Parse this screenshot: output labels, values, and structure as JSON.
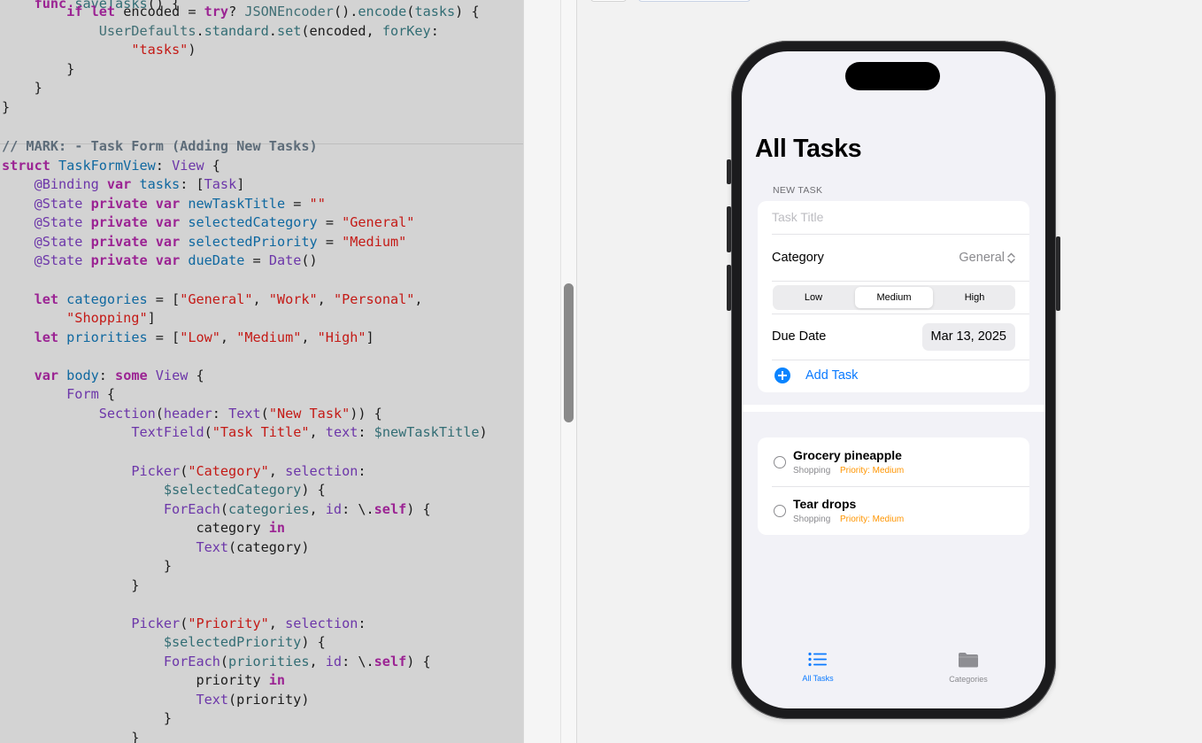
{
  "code_lines": [
    {
      "t": 4,
      "segs": [
        [
          "    ",
          ""
        ],
        [
          "func",
          "kw"
        ],
        [
          " ",
          ""
        ],
        [
          "saveTasks",
          "fn"
        ],
        [
          "() {",
          ""
        ]
      ]
    },
    {
      "t": 13,
      "segs": [
        [
          "        ",
          ""
        ],
        [
          "if",
          "kw"
        ],
        [
          " ",
          ""
        ],
        [
          "let",
          "kw"
        ],
        [
          " encoded = ",
          ""
        ],
        [
          "try",
          "kw"
        ],
        [
          "? ",
          ""
        ],
        [
          "JSONEncoder",
          "ty"
        ],
        [
          "().",
          ""
        ],
        [
          "encode",
          "fn"
        ],
        [
          "(",
          ""
        ],
        [
          "tasks",
          "fn"
        ],
        [
          ") {",
          ""
        ]
      ]
    },
    {
      "t": 35,
      "segs": [
        [
          "            ",
          ""
        ],
        [
          "UserDefaults",
          "ty"
        ],
        [
          ".",
          ""
        ],
        [
          "standard",
          "fn"
        ],
        [
          ".",
          ""
        ],
        [
          "set",
          "fn"
        ],
        [
          "(encoded, ",
          ""
        ],
        [
          "forKey",
          "fn"
        ],
        [
          ":",
          ""
        ]
      ]
    },
    {
      "t": 56,
      "segs": [
        [
          "                ",
          ""
        ],
        [
          "\"tasks\"",
          "str"
        ],
        [
          ")",
          ""
        ]
      ]
    },
    {
      "t": 78,
      "segs": [
        [
          "        }",
          ""
        ]
      ]
    },
    {
      "t": 99,
      "segs": [
        [
          "    }",
          ""
        ]
      ]
    },
    {
      "t": 121,
      "segs": [
        [
          "}",
          ""
        ]
      ]
    },
    {
      "t": 165,
      "segs": [
        [
          "// MARK: - Task Form (Adding New Tasks)",
          "cm"
        ]
      ]
    },
    {
      "t": 187,
      "segs": [
        [
          "struct",
          "kw"
        ],
        [
          " ",
          ""
        ],
        [
          "TaskFormView",
          "id"
        ],
        [
          ": ",
          ""
        ],
        [
          "View",
          "pr"
        ],
        [
          " {",
          ""
        ]
      ]
    },
    {
      "t": 208,
      "segs": [
        [
          "    ",
          ""
        ],
        [
          "@Binding",
          "pr"
        ],
        [
          " ",
          ""
        ],
        [
          "var",
          "kw"
        ],
        [
          " ",
          ""
        ],
        [
          "tasks",
          "id"
        ],
        [
          ": [",
          ""
        ],
        [
          "Task",
          "pr"
        ],
        [
          "]",
          ""
        ]
      ]
    },
    {
      "t": 230,
      "segs": [
        [
          "    ",
          ""
        ],
        [
          "@State",
          "pr"
        ],
        [
          " ",
          ""
        ],
        [
          "private",
          "kw"
        ],
        [
          " ",
          ""
        ],
        [
          "var",
          "kw"
        ],
        [
          " ",
          ""
        ],
        [
          "newTaskTitle",
          "id"
        ],
        [
          " = ",
          ""
        ],
        [
          "\"\"",
          "str"
        ]
      ]
    },
    {
      "t": 251,
      "segs": [
        [
          "    ",
          ""
        ],
        [
          "@State",
          "pr"
        ],
        [
          " ",
          ""
        ],
        [
          "private",
          "kw"
        ],
        [
          " ",
          ""
        ],
        [
          "var",
          "kw"
        ],
        [
          " ",
          ""
        ],
        [
          "selectedCategory",
          "id"
        ],
        [
          " = ",
          ""
        ],
        [
          "\"General\"",
          "str"
        ]
      ]
    },
    {
      "t": 273,
      "segs": [
        [
          "    ",
          ""
        ],
        [
          "@State",
          "pr"
        ],
        [
          " ",
          ""
        ],
        [
          "private",
          "kw"
        ],
        [
          " ",
          ""
        ],
        [
          "var",
          "kw"
        ],
        [
          " ",
          ""
        ],
        [
          "selectedPriority",
          "id"
        ],
        [
          " = ",
          ""
        ],
        [
          "\"Medium\"",
          "str"
        ]
      ]
    },
    {
      "t": 294,
      "segs": [
        [
          "    ",
          ""
        ],
        [
          "@State",
          "pr"
        ],
        [
          " ",
          ""
        ],
        [
          "private",
          "kw"
        ],
        [
          " ",
          ""
        ],
        [
          "var",
          "kw"
        ],
        [
          " ",
          ""
        ],
        [
          "dueDate",
          "id"
        ],
        [
          " = ",
          ""
        ],
        [
          "Date",
          "pr"
        ],
        [
          "()",
          ""
        ]
      ]
    },
    {
      "t": 338,
      "segs": [
        [
          "    ",
          ""
        ],
        [
          "let",
          "kw"
        ],
        [
          " ",
          ""
        ],
        [
          "categories",
          "id"
        ],
        [
          " = [",
          ""
        ],
        [
          "\"General\"",
          "str"
        ],
        [
          ", ",
          ""
        ],
        [
          "\"Work\"",
          "str"
        ],
        [
          ", ",
          ""
        ],
        [
          "\"Personal\"",
          "str"
        ],
        [
          ",",
          ""
        ]
      ]
    },
    {
      "t": 359,
      "segs": [
        [
          "        ",
          ""
        ],
        [
          "\"Shopping\"",
          "str"
        ],
        [
          "]",
          ""
        ]
      ]
    },
    {
      "t": 381,
      "segs": [
        [
          "    ",
          ""
        ],
        [
          "let",
          "kw"
        ],
        [
          " ",
          ""
        ],
        [
          "priorities",
          "id"
        ],
        [
          " = [",
          ""
        ],
        [
          "\"Low\"",
          "str"
        ],
        [
          ", ",
          ""
        ],
        [
          "\"Medium\"",
          "str"
        ],
        [
          ", ",
          ""
        ],
        [
          "\"High\"",
          "str"
        ],
        [
          "]",
          ""
        ]
      ]
    },
    {
      "t": 424,
      "segs": [
        [
          "    ",
          ""
        ],
        [
          "var",
          "kw"
        ],
        [
          " ",
          ""
        ],
        [
          "body",
          "id"
        ],
        [
          ": ",
          ""
        ],
        [
          "some",
          "kw"
        ],
        [
          " ",
          ""
        ],
        [
          "View",
          "pr"
        ],
        [
          " {",
          ""
        ]
      ]
    },
    {
      "t": 445,
      "segs": [
        [
          "        ",
          ""
        ],
        [
          "Form",
          "pr"
        ],
        [
          " {",
          ""
        ]
      ]
    },
    {
      "t": 467,
      "segs": [
        [
          "            ",
          ""
        ],
        [
          "Section",
          "pr"
        ],
        [
          "(",
          ""
        ],
        [
          "header",
          "pr"
        ],
        [
          ": ",
          ""
        ],
        [
          "Text",
          "pr"
        ],
        [
          "(",
          ""
        ],
        [
          "\"New Task\"",
          "str"
        ],
        [
          ")) {",
          ""
        ]
      ]
    },
    {
      "t": 488,
      "segs": [
        [
          "                ",
          ""
        ],
        [
          "TextField",
          "pr"
        ],
        [
          "(",
          ""
        ],
        [
          "\"Task Title\"",
          "str"
        ],
        [
          ", ",
          ""
        ],
        [
          "text",
          "pr"
        ],
        [
          ": ",
          ""
        ],
        [
          "$newTaskTitle",
          "fn"
        ],
        [
          ")",
          ""
        ]
      ]
    },
    {
      "t": 532,
      "segs": [
        [
          "                ",
          ""
        ],
        [
          "Picker",
          "pr"
        ],
        [
          "(",
          ""
        ],
        [
          "\"Category\"",
          "str"
        ],
        [
          ", ",
          ""
        ],
        [
          "selection",
          "pr"
        ],
        [
          ":",
          ""
        ]
      ]
    },
    {
      "t": 553,
      "segs": [
        [
          "                    ",
          ""
        ],
        [
          "$selectedCategory",
          "fn"
        ],
        [
          ") {",
          ""
        ]
      ]
    },
    {
      "t": 575,
      "segs": [
        [
          "                    ",
          ""
        ],
        [
          "ForEach",
          "pr"
        ],
        [
          "(",
          ""
        ],
        [
          "categories",
          "fn"
        ],
        [
          ", ",
          ""
        ],
        [
          "id",
          "pr"
        ],
        [
          ": \\.",
          ""
        ],
        [
          "self",
          "kw"
        ],
        [
          ") {",
          ""
        ]
      ]
    },
    {
      "t": 596,
      "segs": [
        [
          "                        category ",
          ""
        ],
        [
          "in",
          "kw"
        ]
      ]
    },
    {
      "t": 618,
      "segs": [
        [
          "                        ",
          ""
        ],
        [
          "Text",
          "pr"
        ],
        [
          "(category)",
          ""
        ]
      ]
    },
    {
      "t": 639,
      "segs": [
        [
          "                    }",
          ""
        ]
      ]
    },
    {
      "t": 661,
      "segs": [
        [
          "                }",
          ""
        ]
      ]
    },
    {
      "t": 704,
      "segs": [
        [
          "                ",
          ""
        ],
        [
          "Picker",
          "pr"
        ],
        [
          "(",
          ""
        ],
        [
          "\"Priority\"",
          "str"
        ],
        [
          ", ",
          ""
        ],
        [
          "selection",
          "pr"
        ],
        [
          ":",
          ""
        ]
      ]
    },
    {
      "t": 725,
      "segs": [
        [
          "                    ",
          ""
        ],
        [
          "$selectedPriority",
          "fn"
        ],
        [
          ") {",
          ""
        ]
      ]
    },
    {
      "t": 747,
      "segs": [
        [
          "                    ",
          ""
        ],
        [
          "ForEach",
          "pr"
        ],
        [
          "(",
          ""
        ],
        [
          "priorities",
          "fn"
        ],
        [
          ", ",
          ""
        ],
        [
          "id",
          "pr"
        ],
        [
          ": \\.",
          ""
        ],
        [
          "self",
          "kw"
        ],
        [
          ") {",
          ""
        ]
      ]
    },
    {
      "t": 768,
      "segs": [
        [
          "                        priority ",
          ""
        ],
        [
          "in",
          "kw"
        ]
      ]
    },
    {
      "t": 790,
      "segs": [
        [
          "                        ",
          ""
        ],
        [
          "Text",
          "pr"
        ],
        [
          "(priority)",
          ""
        ]
      ]
    },
    {
      "t": 811,
      "segs": [
        [
          "                    }",
          ""
        ]
      ]
    },
    {
      "t": 833,
      "segs": [
        [
          "                }",
          ""
        ]
      ]
    }
  ],
  "app": {
    "title": "All Tasks",
    "form": {
      "section_header": "NEW TASK",
      "title_placeholder": "Task Title",
      "category_label": "Category",
      "category_value": "General",
      "priorities": [
        "Low",
        "Medium",
        "High"
      ],
      "selected_priority": "Medium",
      "due_date_label": "Due Date",
      "due_date_value": "Mar 13, 2025",
      "add_label": "Add Task"
    },
    "tasks": [
      {
        "title": "Grocery pineapple",
        "category": "Shopping",
        "priority": "Priority: Medium"
      },
      {
        "title": "Tear drops",
        "category": "Shopping",
        "priority": "Priority: Medium"
      }
    ],
    "tabs": [
      {
        "label": "All Tasks",
        "icon": "list-icon",
        "active": true
      },
      {
        "label": "Categories",
        "icon": "folder-icon",
        "active": false
      }
    ]
  },
  "colors": {
    "accent": "#0a7aff",
    "priority_medium": "#ff9500",
    "editor_bg": "#d3d3d3"
  }
}
